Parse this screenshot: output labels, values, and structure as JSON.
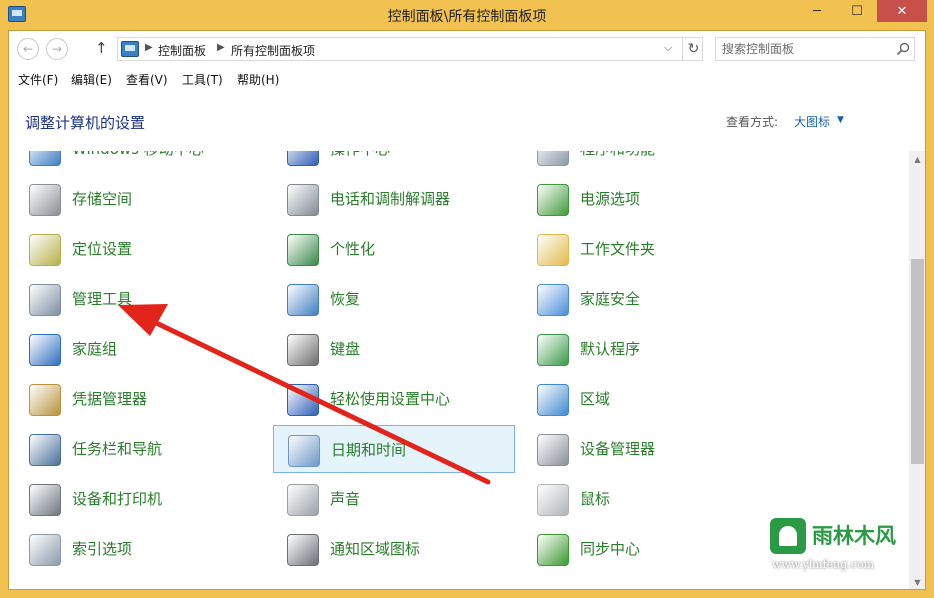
{
  "window": {
    "title": "控制面板\\所有控制面板项",
    "minimize_glyph": "─",
    "maximize_glyph": "☐",
    "close_glyph": "✕"
  },
  "nav": {
    "back_glyph": "←",
    "forward_glyph": "→",
    "up_glyph": "↑",
    "crumb_sep": "▶",
    "breadcrumbs": [
      "控制面板",
      "所有控制面板项"
    ],
    "dropdown_glyph": "⌵",
    "refresh_glyph": "↻"
  },
  "search": {
    "placeholder": "搜索控制面板"
  },
  "menu": [
    "文件(F)",
    "编辑(E)",
    "查看(V)",
    "工具(T)",
    "帮助(H)"
  ],
  "header": {
    "heading": "调整计算机的设置",
    "view_label": "查看方式:",
    "view_value": "大图标",
    "view_caret": "▼"
  },
  "items": [
    {
      "label": "Windows 移动中心",
      "icon": "windows-mobility-icon",
      "color": "#3f7ec2"
    },
    {
      "label": "操作中心",
      "icon": "action-center-flag-icon",
      "color": "#2f5db4"
    },
    {
      "label": "程序和功能",
      "icon": "programs-features-icon",
      "color": "#8c9aa8"
    },
    {
      "label": "存储空间",
      "icon": "storage-spaces-icon",
      "color": "#8a8f96"
    },
    {
      "label": "电话和调制解调器",
      "icon": "phone-modem-icon",
      "color": "#7f8a94"
    },
    {
      "label": "电源选项",
      "icon": "power-options-icon",
      "color": "#3e9a3a"
    },
    {
      "label": "定位设置",
      "icon": "location-settings-icon",
      "color": "#b6b04a"
    },
    {
      "label": "个性化",
      "icon": "personalization-icon",
      "color": "#3a8a4a"
    },
    {
      "label": "工作文件夹",
      "icon": "work-folders-icon",
      "color": "#e2b94a"
    },
    {
      "label": "管理工具",
      "icon": "admin-tools-icon",
      "color": "#7d8ea3"
    },
    {
      "label": "恢复",
      "icon": "recovery-icon",
      "color": "#3f7ec2"
    },
    {
      "label": "家庭安全",
      "icon": "family-safety-icon",
      "color": "#4a8ed6"
    },
    {
      "label": "家庭组",
      "icon": "homegroup-icon",
      "color": "#2f6fc0"
    },
    {
      "label": "键盘",
      "icon": "keyboard-icon",
      "color": "#6d6d6d"
    },
    {
      "label": "默认程序",
      "icon": "default-programs-icon",
      "color": "#3b9a4a"
    },
    {
      "label": "凭据管理器",
      "icon": "credential-manager-icon",
      "color": "#b8923c"
    },
    {
      "label": "轻松使用设置中心",
      "icon": "ease-of-access-icon",
      "color": "#2f5fb6"
    },
    {
      "label": "区域",
      "icon": "region-globe-icon",
      "color": "#3f8ad0"
    },
    {
      "label": "任务栏和导航",
      "icon": "taskbar-navigation-icon",
      "color": "#4a6f9a"
    },
    {
      "label": "日期和时间",
      "icon": "date-time-icon",
      "color": "#6e97c8"
    },
    {
      "label": "设备管理器",
      "icon": "device-manager-icon",
      "color": "#8a9099"
    },
    {
      "label": "设备和打印机",
      "icon": "devices-printers-icon",
      "color": "#6d7680"
    },
    {
      "label": "声音",
      "icon": "sound-speaker-icon",
      "color": "#9aa0a6"
    },
    {
      "label": "鼠标",
      "icon": "mouse-icon",
      "color": "#b0b4b8"
    },
    {
      "label": "索引选项",
      "icon": "indexing-options-icon",
      "color": "#8a9aaa"
    },
    {
      "label": "通知区域图标",
      "icon": "notification-area-icon",
      "color": "#6b7077"
    },
    {
      "label": "同步中心",
      "icon": "sync-center-icon",
      "color": "#3a9a2e"
    }
  ],
  "selected_item": "日期和时间",
  "scrollbar": {
    "up_glyph": "▲",
    "down_glyph": "▼"
  },
  "watermark": {
    "name": "雨林木风",
    "url": "www.ylmfeng.com"
  },
  "colors": {
    "frame": "#f2c250",
    "item_text": "#2a7d2a",
    "heading_text": "#1e3287",
    "link_text": "#1a5fb4",
    "selection": "#e5f3fb",
    "arrow": "#e3241b"
  }
}
